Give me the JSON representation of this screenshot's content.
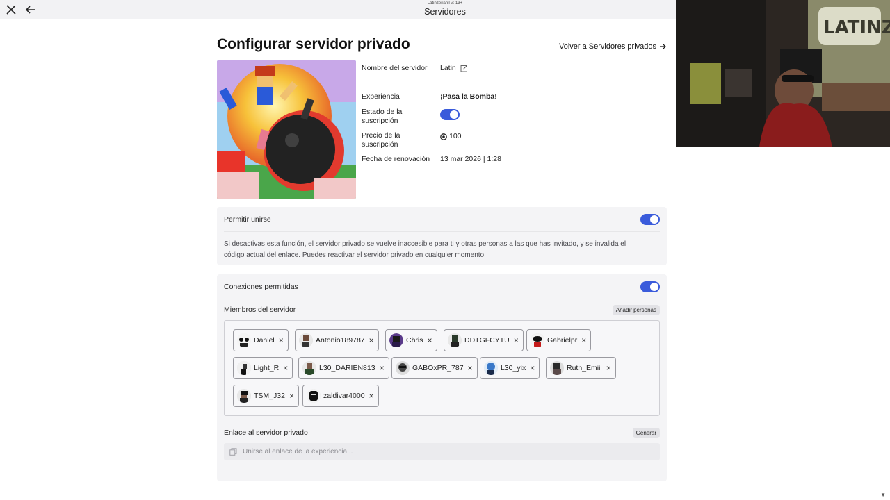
{
  "window": {
    "stream_tag": "LatinzerianTV: 13+",
    "title": "Servidores"
  },
  "page": {
    "title": "Configurar servidor privado",
    "back_link": "Volver a Servidores privados"
  },
  "info": {
    "server_name_label": "Nombre del servidor",
    "server_name_value": "Latin",
    "experience_label": "Experiencia",
    "experience_value": "¡Pasa la Bomba!",
    "subscription_state_label_1": "Estado de la",
    "subscription_state_label_2": "suscripción",
    "subscription_state_on": true,
    "subscription_price_label_1": "Precio de la",
    "subscription_price_label_2": "suscripción",
    "subscription_price_value": "100",
    "renewal_label": "Fecha de renovación",
    "renewal_value": "13 mar 2026 | 1:28"
  },
  "allow_join": {
    "label": "Permitir unirse",
    "enabled": true,
    "description_1": "Si desactivas esta función, el servidor privado se vuelve inaccesible para ti y otras personas a las que has invitado, y se invalida el",
    "description_2": "código actual del enlace. Puedes reactivar el servidor privado en cualquier momento."
  },
  "connections": {
    "label": "Conexiones permitidas",
    "enabled": true
  },
  "members": {
    "label": "Miembros del servidor",
    "add_button": "Añadir personas",
    "list": [
      {
        "name": "Daniel"
      },
      {
        "name": "Antonio189787"
      },
      {
        "name": "Chris"
      },
      {
        "name": "DDTGFCYTU"
      },
      {
        "name": "Gabrielpr"
      },
      {
        "name": "Light_R"
      },
      {
        "name": "L30_DARIEN813"
      },
      {
        "name": "GABOxPR_787"
      },
      {
        "name": "L30_yix"
      },
      {
        "name": "Ruth_Emiii"
      },
      {
        "name": "TSM_J32"
      },
      {
        "name": "zaldivar4000"
      }
    ]
  },
  "private_link": {
    "label": "Enlace al servidor privado",
    "generate_button": "Generar",
    "placeholder": "Unirse al enlace de la experiencia..."
  },
  "colors": {
    "toggle_on": "#3a5bdb",
    "card_bg": "#f4f4f6",
    "topbar_bg": "#f2f2f4"
  }
}
